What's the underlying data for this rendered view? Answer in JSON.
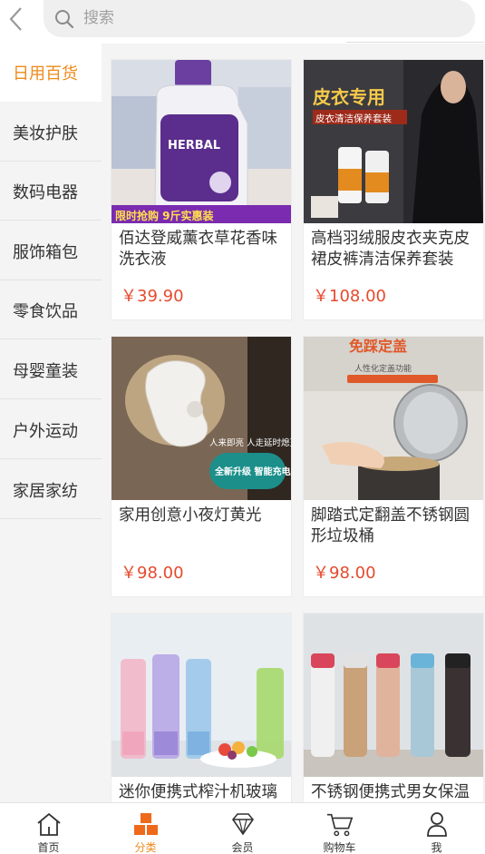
{
  "header": {
    "search_placeholder": "搜索",
    "back_icon": "chevron-left-icon",
    "search_icon": "search-icon"
  },
  "sidebar": {
    "items": [
      {
        "label": "日用百货",
        "active": true
      },
      {
        "label": "美妆护肤",
        "active": false
      },
      {
        "label": "数码电器",
        "active": false
      },
      {
        "label": "服饰箱包",
        "active": false
      },
      {
        "label": "零食饮品",
        "active": false
      },
      {
        "label": "母婴童装",
        "active": false
      },
      {
        "label": "户外运动",
        "active": false
      },
      {
        "label": "家居家纺",
        "active": false
      }
    ]
  },
  "products": [
    {
      "name": "佰达登威薰衣草花香味洗衣液",
      "price": "￥39.90",
      "image_text_top": "HERBAL",
      "image_text_bottom": "限时抢购  9斤实惠装"
    },
    {
      "name": "高档羽绒服皮衣夹克皮裙皮裤清洁保养套装",
      "price": "￥108.00",
      "image_text_top": "皮衣专用",
      "image_text_bottom": "皮衣清洁保养套装"
    },
    {
      "name": "家用创意小夜灯黄光",
      "price": "￥98.00",
      "image_text_top": "人来即亮 人走延时熄灭",
      "image_text_bottom": "全新升级 智能充电版"
    },
    {
      "name": "脚踏式定翻盖不锈钢圆形垃圾桶",
      "price": "￥98.00",
      "image_text_top": "免踩定盖",
      "image_text_bottom": "人性化定盖功能"
    },
    {
      "name": "迷你便携式榨汁机玻璃",
      "price": "",
      "image_text_top": "",
      "image_text_bottom": ""
    },
    {
      "name": "不锈钢便携式男女保温",
      "price": "",
      "image_text_top": "",
      "image_text_bottom": ""
    }
  ],
  "bottom_nav": {
    "items": [
      {
        "label": "首页",
        "icon": "home-icon",
        "active": false
      },
      {
        "label": "分类",
        "icon": "category-icon",
        "active": true
      },
      {
        "label": "会员",
        "icon": "diamond-icon",
        "active": false
      },
      {
        "label": "购物车",
        "icon": "cart-icon",
        "active": false
      },
      {
        "label": "我",
        "icon": "user-icon",
        "active": false
      }
    ]
  },
  "colors": {
    "accent": "#ee8a1a",
    "price": "#e64a2e",
    "sidebar_bg": "#f4f4f4"
  }
}
